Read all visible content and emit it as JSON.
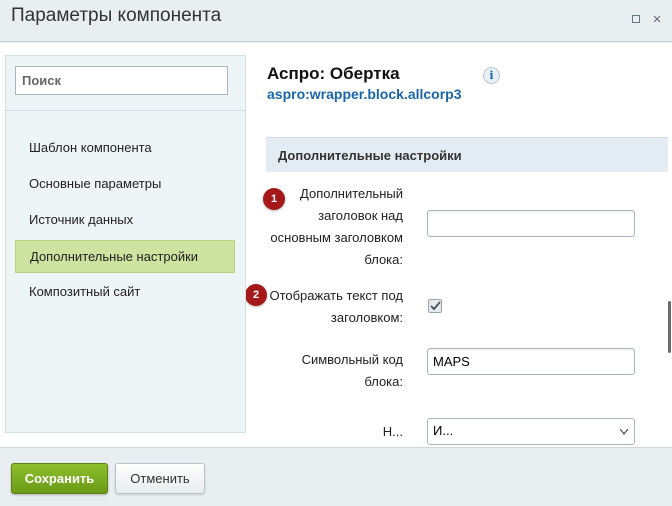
{
  "window": {
    "title": "Параметры компонента",
    "maximize_icon": "maximize-icon",
    "close_icon": "close-icon",
    "close_glyph": "×"
  },
  "sidebar": {
    "search_placeholder": "Поиск",
    "items": [
      {
        "label": "Шаблон компонента",
        "active": false
      },
      {
        "label": "Основные параметры",
        "active": false
      },
      {
        "label": "Источник данных",
        "active": false
      },
      {
        "label": "Дополнительные настройки",
        "active": true
      },
      {
        "label": "Композитный сайт",
        "active": false
      }
    ]
  },
  "component": {
    "title": "Аспро: Обертка",
    "code": "aspro:wrapper.block.allcorp3",
    "info_glyph": "i"
  },
  "section": {
    "header": "Дополнительные настройки",
    "fields": [
      {
        "label_lines": [
          "Дополнительный",
          "заголовок над",
          "основным заголовком",
          "блока:"
        ],
        "type": "text",
        "value": "",
        "badge": "1"
      },
      {
        "label_lines": [
          "Отображать текст под",
          "заголовком:"
        ],
        "type": "checkbox",
        "checked": true,
        "badge": "2"
      },
      {
        "label_lines": [
          "Символьный код",
          "блока:"
        ],
        "type": "text",
        "value": "MAPS"
      },
      {
        "label_lines": [
          "Н..."
        ],
        "type": "select",
        "value": "И..."
      }
    ]
  },
  "footer": {
    "save_label": "Сохранить",
    "cancel_label": "Отменить"
  },
  "colors": {
    "active_nav": "#cfe3a0",
    "save_button": "#7aab1f",
    "badge": "#a51818",
    "link": "#1a66a8"
  }
}
